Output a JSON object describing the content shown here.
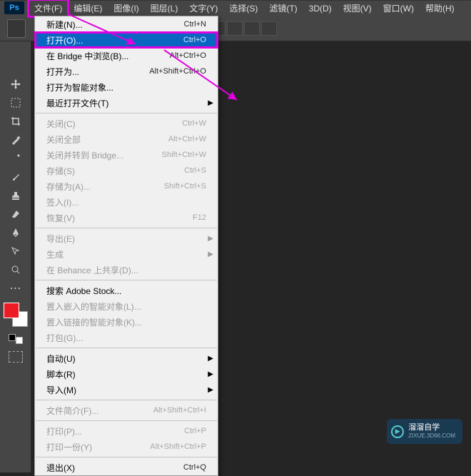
{
  "menubar": {
    "items": [
      "文件(F)",
      "编辑(E)",
      "图像(I)",
      "图层(L)",
      "文字(Y)",
      "选择(S)",
      "滤镜(T)",
      "3D(D)",
      "视图(V)",
      "窗口(W)",
      "帮助(H)"
    ]
  },
  "dropdown": {
    "sections": [
      [
        {
          "label": "新建(N)...",
          "shortcut": "Ctrl+N"
        },
        {
          "label": "打开(O)...",
          "shortcut": "Ctrl+O",
          "highlighted": true
        },
        {
          "label": "在 Bridge 中浏览(B)...",
          "shortcut": "Alt+Ctrl+O"
        },
        {
          "label": "打开为...",
          "shortcut": "Alt+Shift+Ctrl+O"
        },
        {
          "label": "打开为智能对象..."
        },
        {
          "label": "最近打开文件(T)",
          "submenu": true
        }
      ],
      [
        {
          "label": "关闭(C)",
          "shortcut": "Ctrl+W",
          "disabled": true
        },
        {
          "label": "关闭全部",
          "shortcut": "Alt+Ctrl+W",
          "disabled": true
        },
        {
          "label": "关闭并转到 Bridge...",
          "shortcut": "Shift+Ctrl+W",
          "disabled": true
        },
        {
          "label": "存储(S)",
          "shortcut": "Ctrl+S",
          "disabled": true
        },
        {
          "label": "存储为(A)...",
          "shortcut": "Shift+Ctrl+S",
          "disabled": true
        },
        {
          "label": "签入(I)...",
          "disabled": true
        },
        {
          "label": "恢复(V)",
          "shortcut": "F12",
          "disabled": true
        }
      ],
      [
        {
          "label": "导出(E)",
          "submenu": true,
          "disabled": true
        },
        {
          "label": "生成",
          "submenu": true,
          "disabled": true
        },
        {
          "label": "在 Behance 上共享(D)...",
          "disabled": true
        }
      ],
      [
        {
          "label": "搜索 Adobe Stock..."
        },
        {
          "label": "置入嵌入的智能对象(L)...",
          "disabled": true
        },
        {
          "label": "置入链接的智能对象(K)...",
          "disabled": true
        },
        {
          "label": "打包(G)...",
          "disabled": true
        }
      ],
      [
        {
          "label": "自动(U)",
          "submenu": true
        },
        {
          "label": "脚本(R)",
          "submenu": true
        },
        {
          "label": "导入(M)",
          "submenu": true
        }
      ],
      [
        {
          "label": "文件简介(F)...",
          "shortcut": "Alt+Shift+Ctrl+I",
          "disabled": true
        }
      ],
      [
        {
          "label": "打印(P)...",
          "shortcut": "Ctrl+P",
          "disabled": true
        },
        {
          "label": "打印一份(Y)",
          "shortcut": "Alt+Shift+Ctrl+P",
          "disabled": true
        }
      ],
      [
        {
          "label": "退出(X)",
          "shortcut": "Ctrl+Q"
        }
      ]
    ]
  },
  "watermark": {
    "title": "溜溜自学",
    "sub": "ZIXUE.3D66.COM"
  },
  "tools": [
    "move",
    "marquee",
    "crop",
    "wand",
    "eyedropper",
    "brush",
    "stamp",
    "eraser",
    "pen",
    "path",
    "dodge"
  ],
  "annotation_target": "打开(O)..."
}
